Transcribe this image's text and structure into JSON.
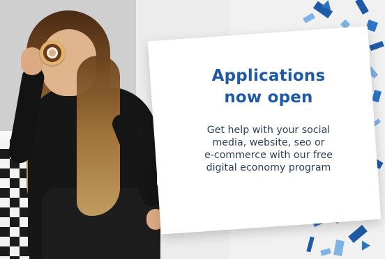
{
  "card": {
    "headline_line1": "Applications",
    "headline_line2": "now open",
    "body_line1": "Get help with your social",
    "body_line2": "media, website, seo or",
    "body_line3": "e-commerce with our free",
    "body_line4": "digital economy program"
  },
  "colors": {
    "brand_blue": "#1f5aa6",
    "accent_blue": "#2e74c5",
    "light_blue": "#7fb2e6",
    "card_background": "#ffffff",
    "body_text": "#2b3f5a"
  }
}
